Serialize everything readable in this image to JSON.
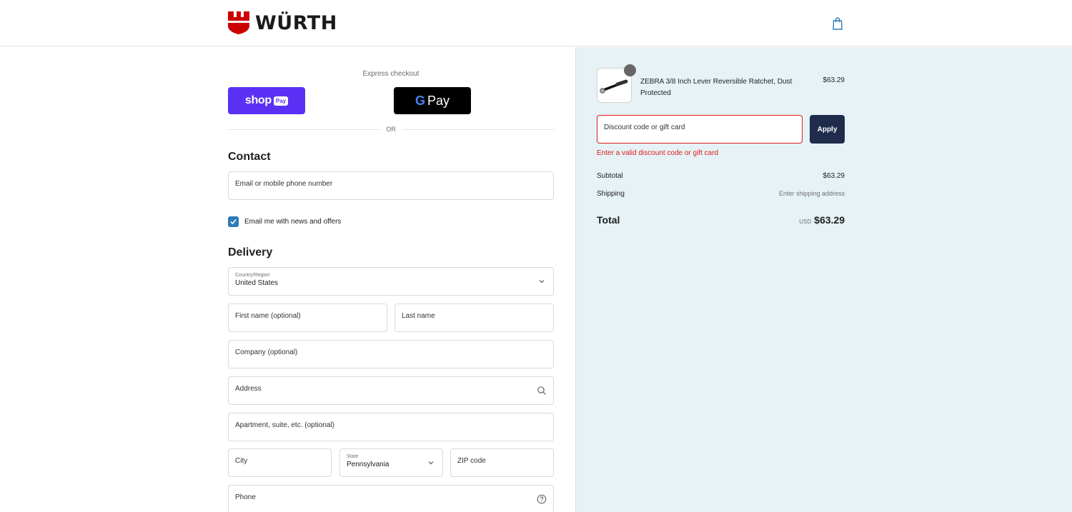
{
  "header": {
    "brand": "WÜRTH",
    "brand_color": "#cc0000",
    "cart_icon": "shopping-bag-icon"
  },
  "express": {
    "title": "Express checkout",
    "shop_label": "shop",
    "shop_chip": "Pay",
    "gpay_g": "G",
    "gpay_label": "Pay",
    "or_label": "OR"
  },
  "contact": {
    "title": "Contact",
    "email_placeholder": "Email or mobile phone number",
    "newsletter_label": "Email me with news and offers",
    "newsletter_checked": true
  },
  "delivery": {
    "title": "Delivery",
    "country_label": "Country/Region",
    "country_value": "United States",
    "first_name": "First name (optional)",
    "last_name": "Last name",
    "company": "Company (optional)",
    "address": "Address",
    "apartment": "Apartment, suite, etc. (optional)",
    "city": "City",
    "state_label": "State",
    "state_value": "Pennsylvania",
    "zip": "ZIP code",
    "phone": "Phone"
  },
  "summary": {
    "product_name": "ZEBRA 3/8 Inch Lever Reversible Ratchet, Dust Protected",
    "product_price": "$63.29",
    "discount_placeholder": "Discount code or gift card",
    "apply_label": "Apply",
    "discount_error": "Enter a valid discount code or gift card",
    "subtotal_label": "Subtotal",
    "subtotal_value": "$63.29",
    "shipping_label": "Shipping",
    "shipping_value": "Enter shipping address",
    "total_label": "Total",
    "total_currency": "USD",
    "total_value": "$63.29"
  },
  "colors": {
    "shop_pay": "#5a31f4",
    "apply_bg": "#1f2c4c",
    "error": "#dd1d1d",
    "summary_bg": "#e6f2f5",
    "checkbox": "#2b7bb9"
  }
}
